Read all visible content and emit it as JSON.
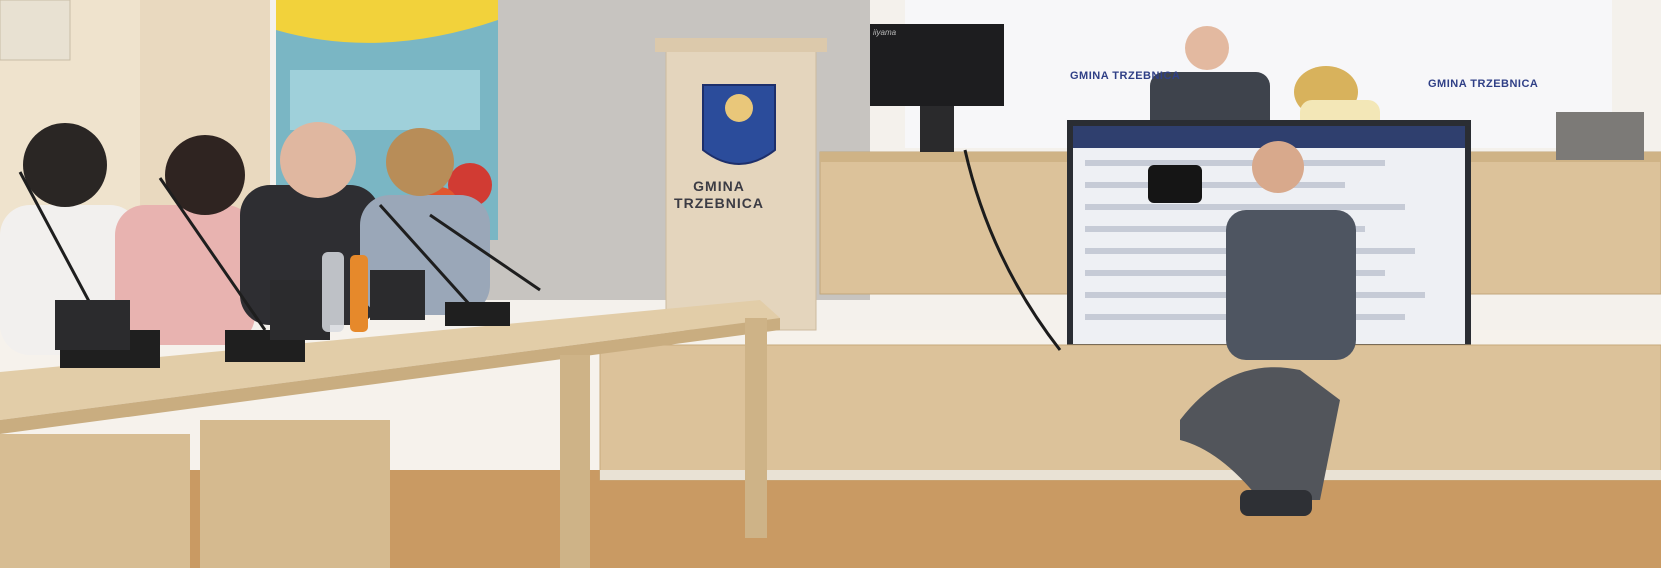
{
  "podium": {
    "line1": "GMINA",
    "line2": "TRZEBNICA"
  },
  "banner": {
    "repeat_text": "GMINA TRZEBNICA"
  },
  "monitor": {
    "brand": "iiyama"
  },
  "colors": {
    "wall": "#f4f1ec",
    "wood": "#d9b98c",
    "floor": "#c99a63",
    "banner": "#f7f7f9",
    "brand_blue": "#2f3f86"
  }
}
